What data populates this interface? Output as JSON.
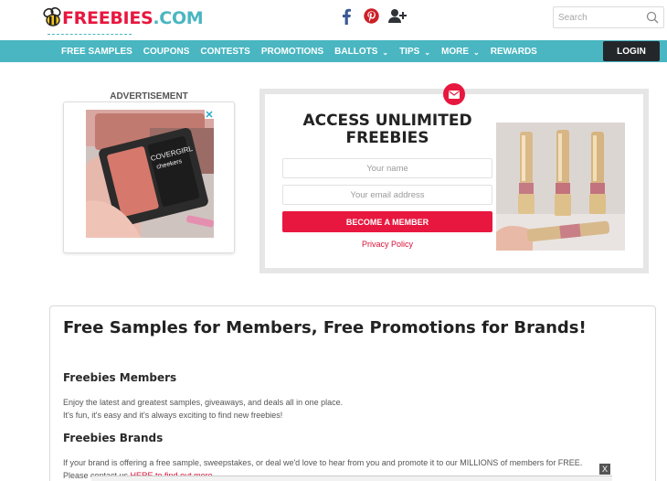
{
  "header": {
    "logo": {
      "part1": "FREEBIES",
      "part2": ".COM"
    },
    "social_icons": [
      "facebook-icon",
      "pinterest-icon",
      "add-user-icon"
    ],
    "search": {
      "placeholder": "Search"
    }
  },
  "nav": {
    "items": [
      {
        "label": "FREE SAMPLES",
        "dropdown": false
      },
      {
        "label": "COUPONS",
        "dropdown": false
      },
      {
        "label": "CONTESTS",
        "dropdown": false
      },
      {
        "label": "PROMOTIONS",
        "dropdown": false
      },
      {
        "label": "BALLOTS",
        "dropdown": true
      },
      {
        "label": "TIPS",
        "dropdown": true
      },
      {
        "label": "MORE",
        "dropdown": true
      },
      {
        "label": "REWARDS",
        "dropdown": false
      }
    ],
    "caret": "⌄",
    "login_label": "LOGIN"
  },
  "advertisement": {
    "label": "ADVERTISEMENT",
    "product_brand": "COVERGIRL",
    "product_name": "cheekers"
  },
  "signup": {
    "title_line1": "ACCESS UNLIMITED",
    "title_line2": "FREEBIES",
    "name_placeholder": "Your name",
    "email_placeholder": "Your email address",
    "button_label": "BECOME A MEMBER",
    "privacy_label": "Privacy Policy"
  },
  "content": {
    "heading": "Free Samples for Members, Free Promotions for Brands!",
    "members_heading": "Freebies Members",
    "members_p1": "Enjoy the latest and greatest samples, giveaways, and deals all in one place.",
    "members_p2": "It's fun, it's easy and it's always exciting to find new freebies!",
    "brands_heading": "Freebies Brands",
    "brands_p1": "If your brand is offering a free sample, sweepstakes, or deal we'd love to hear from you and promote it to our MILLIONS of members for FREE.",
    "brands_p2_prefix": "Please contact us ",
    "brands_p2_link": "HERE to find out more."
  },
  "sticky_ad": {
    "close_label": "X"
  },
  "colors": {
    "brand_red": "#e8173f",
    "brand_teal": "#49b6c1",
    "login_bg": "#24272a",
    "facebook": "#3b5998",
    "pinterest": "#cb2027"
  }
}
